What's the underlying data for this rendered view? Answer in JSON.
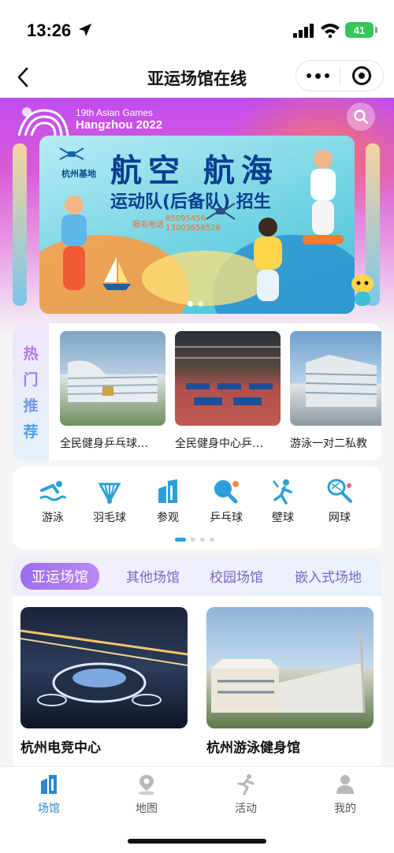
{
  "status_bar": {
    "time": "13:26",
    "battery": "41"
  },
  "nav": {
    "title": "亚运场馆在线"
  },
  "hero": {
    "logo_line1": "19th Asian Games",
    "logo_line2": "Hangzhou 2022",
    "banner": {
      "base_label": "杭州基地",
      "title1": "航空 航海",
      "title2": "运动队(后备队) 招生",
      "phone_label": "报名电话",
      "phone1": "85095456",
      "phone2": "13003658526"
    }
  },
  "hot": {
    "tag_chars": [
      "热",
      "门",
      "推",
      "荐"
    ],
    "items": [
      {
        "name": "全民健身乒乓球…"
      },
      {
        "name": "全民健身中心乒…"
      },
      {
        "name": "游泳一对二私教"
      }
    ]
  },
  "categories": [
    {
      "label": "游泳",
      "icon": "swim-icon"
    },
    {
      "label": "羽毛球",
      "icon": "badminton-icon"
    },
    {
      "label": "参观",
      "icon": "building-icon"
    },
    {
      "label": "乒乓球",
      "icon": "pingpong-icon"
    },
    {
      "label": "壁球",
      "icon": "squash-icon"
    },
    {
      "label": "网球",
      "icon": "tennis-icon"
    }
  ],
  "venue_tabs": [
    "亚运场馆",
    "其他场馆",
    "校园场馆",
    "嵌入式场地"
  ],
  "venues": [
    {
      "name": "杭州电竞中心"
    },
    {
      "name": "杭州游泳健身馆"
    }
  ],
  "tabbar": [
    {
      "label": "场馆",
      "active": true
    },
    {
      "label": "地图",
      "active": false
    },
    {
      "label": "活动",
      "active": false
    },
    {
      "label": "我的",
      "active": false
    }
  ],
  "colors": {
    "accent": "#2c86d0",
    "purple": "#9b6df0",
    "hero_top": "#c04df0"
  }
}
